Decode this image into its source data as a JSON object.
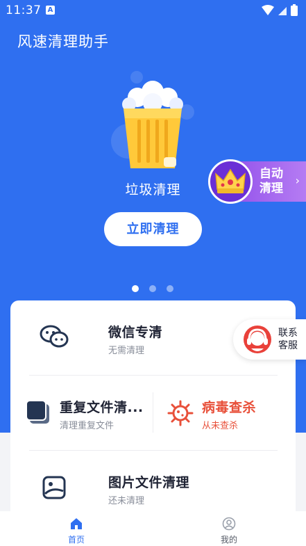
{
  "status": {
    "time": "11:37",
    "notification_letter": "A"
  },
  "app": {
    "title": "风速清理助手"
  },
  "hero": {
    "label": "垃圾清理",
    "button": "立即清理"
  },
  "auto_clean": {
    "line1": "自动",
    "line2": "清理"
  },
  "carousel": {
    "count": 3,
    "active": 0
  },
  "features": {
    "wechat": {
      "title": "微信专清",
      "subtitle": "无需清理"
    },
    "duplicate": {
      "title": "重复文件清...",
      "subtitle": "清理重复文件"
    },
    "virus": {
      "title": "病毒查杀",
      "subtitle": "从未查杀"
    },
    "images": {
      "title": "图片文件清理",
      "subtitle": "还未清理"
    }
  },
  "support": {
    "line1": "联系",
    "line2": "客服"
  },
  "tabs": [
    {
      "label": "首页",
      "active": true,
      "icon": "home-icon"
    },
    {
      "label": "我的",
      "active": false,
      "icon": "profile-icon"
    }
  ],
  "colors": {
    "primary": "#2f6ff0",
    "danger": "#e8503a",
    "text": "#1e2233",
    "muted": "#888d99"
  }
}
